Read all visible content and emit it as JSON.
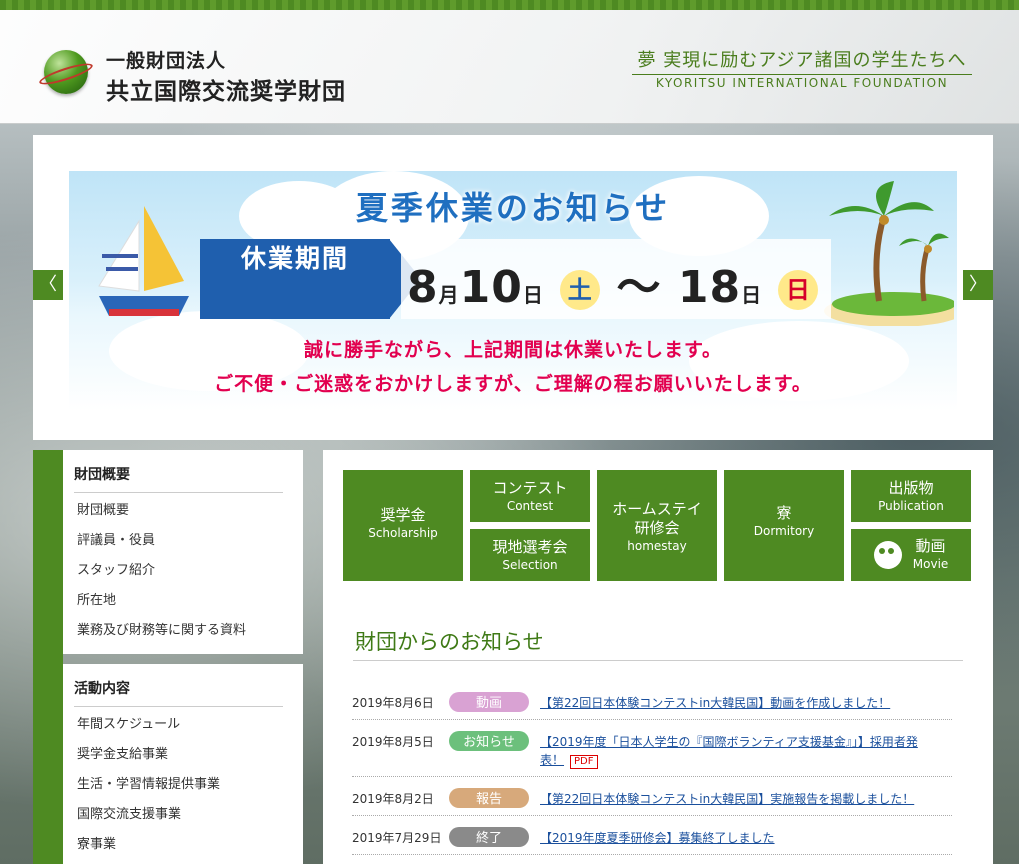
{
  "header": {
    "org_sub": "一般財団法人",
    "org_name": "共立国際交流奨学財団",
    "tagline": "夢 実現に励むアジア諸国の学生たちへ",
    "tagline_en": "KYORITSU INTERNATIONAL FOUNDATION"
  },
  "banner": {
    "title": "夏季休業のお知らせ",
    "period_label": "休業期間",
    "start_month": "8",
    "start_month_unit": "月",
    "start_day": "10",
    "start_day_unit": "日",
    "start_weekday": "土",
    "separator": "〜",
    "end_day": "18",
    "end_day_unit": "日",
    "end_weekday": "日",
    "line1": "誠に勝手ながら、上記期間は休業いたします。",
    "line2": "ご不便・ご迷惑をおかけしますが、ご理解の程お願いいたします。",
    "prev": "〈",
    "next": "〉"
  },
  "sidebar": {
    "section1": {
      "heading": "財団概要",
      "items": [
        "財団概要",
        "評議員・役員",
        "スタッフ紹介",
        "所在地",
        "業務及び財務等に関する資料"
      ]
    },
    "section2": {
      "heading": "活動内容",
      "items": [
        "年間スケジュール",
        "奨学金支給事業",
        "生活・学習情報提供事業",
        "国際交流支援事業",
        "寮事業"
      ]
    }
  },
  "tiles": {
    "scholarship": {
      "ja": "奨学金",
      "en": "Scholarship"
    },
    "contest": {
      "ja": "コンテスト",
      "en": "Contest"
    },
    "selection": {
      "ja": "現地選考会",
      "en": "Selection"
    },
    "homestay": {
      "ja1": "ホームステイ",
      "ja2": "研修会",
      "en": "homestay"
    },
    "dormitory": {
      "ja": "寮",
      "en": "Dormitory"
    },
    "publication": {
      "ja": "出版物",
      "en": "Publication"
    },
    "movie": {
      "ja": "動画",
      "en": "Movie"
    }
  },
  "news": {
    "heading": "財団からのお知らせ",
    "items": [
      {
        "date": "2019年8月6日",
        "badge": "動画",
        "badge_color": "#d9a2d3",
        "title": "【第22回日本体験コンテストin大韓民国】動画を作成しました！"
      },
      {
        "date": "2019年8月5日",
        "badge": "お知らせ",
        "badge_color": "#6cc07c",
        "title": "【2019年度「日本人学生の『国際ボランティア支援基金』」】採用者発表！",
        "tag": "PDF"
      },
      {
        "date": "2019年8月2日",
        "badge": "報告",
        "badge_color": "#d7a97b",
        "title": "【第22回日本体験コンテストin大韓民国】実施報告を掲載しました！"
      },
      {
        "date": "2019年7月29日",
        "badge": "終了",
        "badge_color": "#8a8a8a",
        "title": "【2019年度夏季研修会】募集終了しました"
      }
    ]
  },
  "colors": {
    "brand_green": "#4e8a22",
    "banner_blue": "#1f5fae",
    "notice_pink": "#e2004f",
    "link_blue": "#1a4f9c"
  }
}
